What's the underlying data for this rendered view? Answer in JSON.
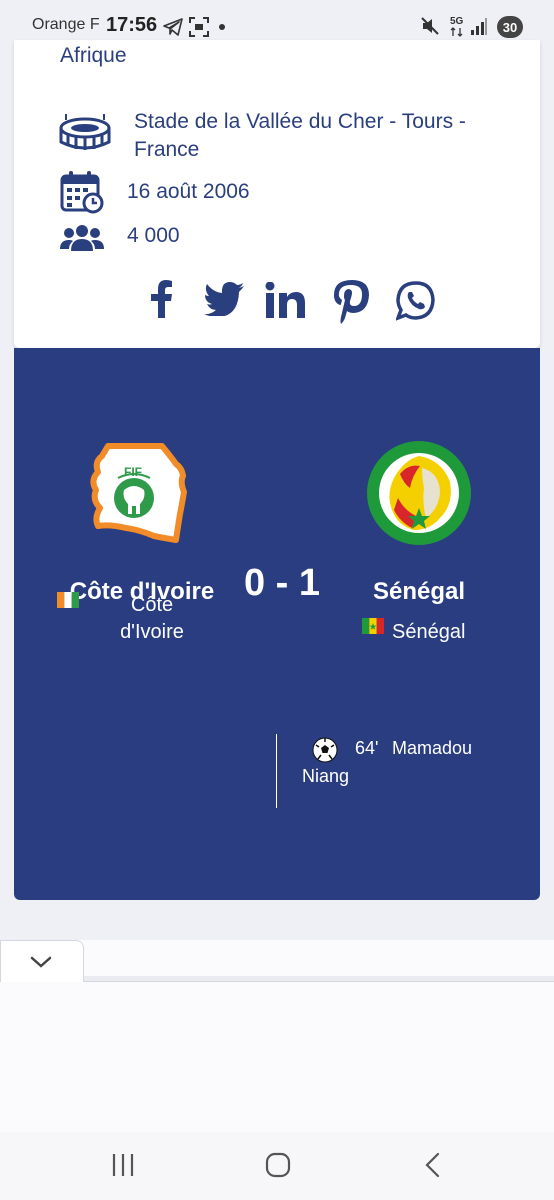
{
  "status_bar": {
    "carrier": "Orange F",
    "time": "17:56",
    "network": "5G",
    "battery": "30"
  },
  "info_card": {
    "cut_text": "Afrique",
    "stadium": "Stade de la Vallée du Cher - Tours - France",
    "date": "16 août 2006",
    "attendance": "4 000",
    "share_icons": [
      "facebook-icon",
      "twitter-icon",
      "linkedin-icon",
      "pinterest-icon",
      "whatsapp-icon"
    ]
  },
  "match": {
    "home": {
      "name": "Côte d'Ivoire",
      "sub_line1": "Côte",
      "sub_line2": "d'Ivoire",
      "crest_text": "FIF"
    },
    "away": {
      "name": "Sénégal",
      "sub": "Sénégal"
    },
    "score": "0 - 1",
    "goals": [
      {
        "minute": "64'",
        "player_first": "Mamadou",
        "player_last": "Niang",
        "side": "away"
      }
    ]
  },
  "colors": {
    "primary_blue": "#293d80",
    "text_blue": "#2a3f7d",
    "ivory_orange": "#f28c28",
    "ivory_green": "#2e9a4a",
    "senegal_green": "#1e9a3a",
    "senegal_yellow": "#f5d000",
    "senegal_red": "#d9262b"
  }
}
